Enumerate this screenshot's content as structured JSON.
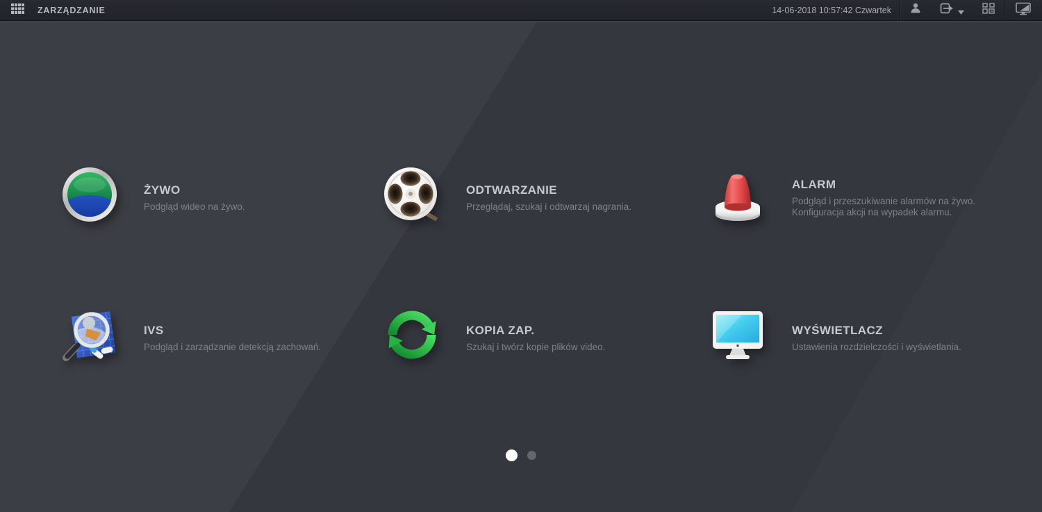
{
  "topbar": {
    "title": "ZARZĄDZANIE",
    "datetime": "14-06-2018 10:57:42 Czwartek"
  },
  "tiles": [
    {
      "title": "ŻYWO",
      "desc": [
        "Podgląd wideo na żywo."
      ]
    },
    {
      "title": "ODTWARZANIE",
      "desc": [
        "Przeglądaj, szukaj i odtwarzaj nagrania."
      ]
    },
    {
      "title": "ALARM",
      "desc": [
        "Podgląd i przeszukiwanie alarmów na żywo.",
        "Konfiguracja akcji na wypadek alarmu."
      ]
    },
    {
      "title": "IVS",
      "desc": [
        "Podgląd i zarządzanie detekcją zachowań."
      ]
    },
    {
      "title": "KOPIA ZAP.",
      "desc": [
        "Szukaj i twórz kopie plików video."
      ]
    },
    {
      "title": "WYŚWIETLACZ",
      "desc": [
        "Ustawienia rozdzielczości i wyświetlania."
      ]
    }
  ],
  "pagination": {
    "pages": 2,
    "active_page": 1
  },
  "colors": {
    "topbar_bg": "#23262c",
    "body_bg": "#34373e",
    "live_green": "#1d9e54",
    "live_blue": "#0b2d91",
    "alarm_red": "#d84040",
    "backup_green": "#2fbf45",
    "screen_cyan": "#45cdee",
    "ivs_blue": "#2e58c8",
    "active_dot": "#ffffff",
    "inactive_dot": "#64676d"
  }
}
